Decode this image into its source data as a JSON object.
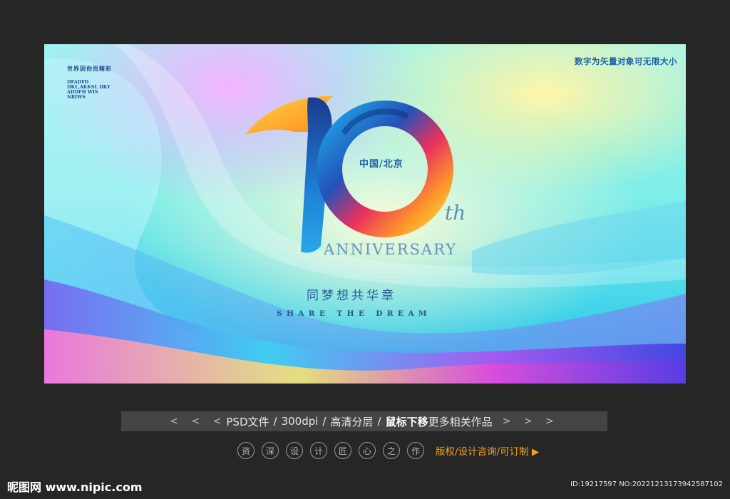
{
  "poster": {
    "tagline_cn": "世界因你而精彩",
    "tagline_en": "DFADFD\nDKL,AKKSL DKY\nADDFH WIS\nNRIWS",
    "vector_note": "数字为矢量对象可无限大小",
    "place": "中国/北京",
    "number": "10",
    "ordinal": "th",
    "anniversary": "ANNIVERSARY",
    "slogan_cn": "同梦想共华章",
    "slogan_en": "SHARE THE DREAM"
  },
  "infobar": {
    "left_arrows": "< < <",
    "format": "PSD文件",
    "dpi": "300dpi",
    "layers": "高清分层",
    "hover_bold": "鼠标下移",
    "hover_rest": "更多相关作品",
    "right_arrows": "> > >"
  },
  "promo": {
    "circles": [
      "资",
      "深",
      "设",
      "计",
      "匠",
      "心",
      "之",
      "作"
    ],
    "design_link": "版权/设计咨询/可订制 ▶"
  },
  "footer": {
    "brand": "昵图网 www.nipic.com",
    "id_line": "ID:19217597 NO:20221213173942587102"
  },
  "colors": {
    "page_bg": "#262626",
    "infobar_bg": "#444444",
    "accent_orange": "#f2a31a",
    "text_blue": "#1d63a8"
  }
}
